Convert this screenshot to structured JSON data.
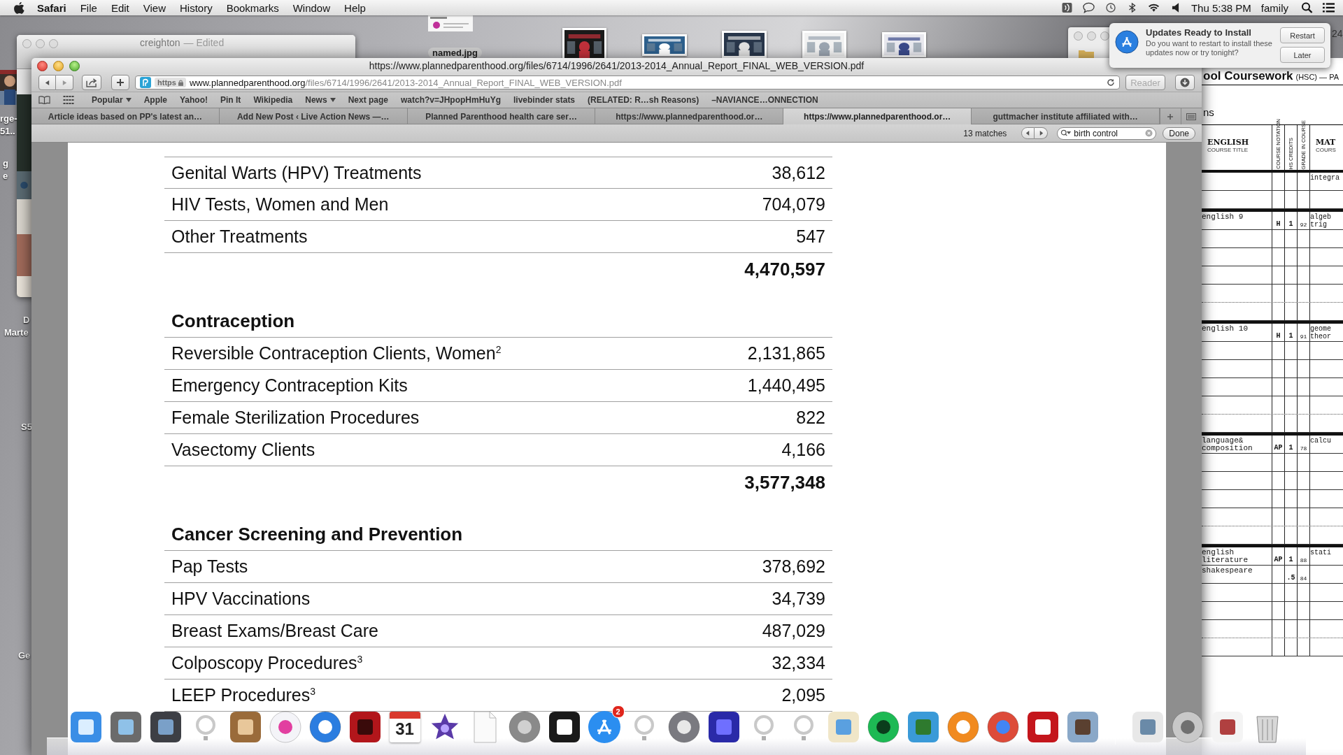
{
  "menu_bar": {
    "app": "Safari",
    "items": [
      "File",
      "Edit",
      "View",
      "History",
      "Bookmarks",
      "Window",
      "Help"
    ],
    "clock": "Thu 5:38 PM",
    "user": "family"
  },
  "desktop": {
    "labels": [
      "rge-",
      "51..",
      "g",
      "e",
      "D",
      "Marte",
      "S5",
      "Ge"
    ],
    "thumbnail_label": "named.jpg",
    "window_fragment": "24"
  },
  "background_window": {
    "title": "creighton",
    "status": "— Edited"
  },
  "safari": {
    "title": "https://www.plannedparenthood.org/files/6714/1996/2641/2013-2014_Annual_Report_FINAL_WEB_VERSION.pdf",
    "address": {
      "scheme": "https",
      "host": "www.plannedparenthood.org",
      "path": "/files/6714/1996/2641/2013-2014_Annual_Report_FINAL_WEB_VERSION.pdf"
    },
    "reader": "Reader",
    "bookmarks": [
      {
        "label": "Popular",
        "menu": true
      },
      {
        "label": "Apple",
        "menu": false
      },
      {
        "label": "Yahoo!",
        "menu": false
      },
      {
        "label": "Pin It",
        "menu": false
      },
      {
        "label": "Wikipedia",
        "menu": false
      },
      {
        "label": "News",
        "menu": true
      },
      {
        "label": "Next page",
        "menu": false
      },
      {
        "label": "watch?v=JHpopHmHuYg",
        "menu": false
      },
      {
        "label": "livebinder stats",
        "menu": false
      },
      {
        "label": "(RELATED: R…sh Reasons)",
        "menu": false
      },
      {
        "label": "–NAVIANCE…ONNECTION",
        "menu": false
      }
    ],
    "tabs": [
      {
        "label": "Article ideas based on PP's latest an…",
        "selected": false
      },
      {
        "label": "Add New Post ‹ Live Action News —…",
        "selected": false
      },
      {
        "label": "Planned Parenthood health care ser…",
        "selected": false
      },
      {
        "label": "https://www.plannedparenthood.or…",
        "selected": false
      },
      {
        "label": "https://www.plannedparenthood.or…",
        "selected": true
      },
      {
        "label": "guttmacher institute affiliated with…",
        "selected": false
      }
    ],
    "find": {
      "matches": "13 matches",
      "query": "birth control",
      "done": "Done"
    }
  },
  "report": {
    "sections": [
      {
        "rows": [
          {
            "label": "Genital Warts (HPV) Treatments",
            "value": "38,612"
          },
          {
            "label": "HIV Tests, Women and Men",
            "value": "704,079"
          },
          {
            "label": "Other Treatments",
            "value": "547"
          }
        ],
        "total": "4,470,597"
      },
      {
        "heading": "Contraception",
        "rows": [
          {
            "label": "Reversible Contraception Clients, Women$^{2}$",
            "value": "2,131,865"
          },
          {
            "label": "Emergency Contraception Kits",
            "value": "1,440,495"
          },
          {
            "label": "Female Sterilization Procedures",
            "value": "822"
          },
          {
            "label": "Vasectomy Clients",
            "value": "4,166"
          }
        ],
        "total": "3,577,348"
      },
      {
        "heading": "Cancer Screening and Prevention",
        "rows": [
          {
            "label": "Pap Tests",
            "value": "378,692"
          },
          {
            "label": "HPV Vaccinations",
            "value": "34,739"
          },
          {
            "label": "Breast Exams/Breast Care",
            "value": "487,029"
          },
          {
            "label": "Colposcopy Procedures$^{3}$",
            "value": "32,334"
          },
          {
            "label": "LEEP Procedures$^{3}$",
            "value": "2,095"
          }
        ]
      }
    ]
  },
  "coursework": {
    "title": "ool Coursework",
    "subtitle": "(HSC) — PA",
    "heading": "ns",
    "columns": {
      "subject": "ENGLISH",
      "title": "COURSE TITLE",
      "notation": "COURSE NOTATION",
      "credits": "HS CREDITS",
      "grade": "GRADE IN COURSE",
      "math": "MAT",
      "math_title": "COURS"
    },
    "groups": [
      {
        "rows": [
          {
            "math": "integra"
          }
        ]
      },
      {
        "rows": [
          {
            "title": "english 9",
            "notation": "H",
            "credits": "1",
            "grade": "92",
            "math": "algeb trig"
          }
        ]
      },
      {
        "rows": [
          {
            "title": "english 10",
            "notation": "H",
            "credits": "1",
            "grade": "91",
            "math": "geome theor"
          }
        ]
      },
      {
        "rows": [
          {
            "title": "language& composition",
            "notation": "AP",
            "credits": "1",
            "grade": "78",
            "math": "calcu"
          }
        ]
      },
      {
        "rows": [
          {
            "title": "english literature",
            "notation": "AP",
            "credits": "1",
            "grade": "88",
            "math": "stati"
          },
          {
            "title": "shakespeare",
            "credits": ".5",
            "grade": "84"
          }
        ]
      }
    ]
  },
  "notification": {
    "title": "Updates Ready to Install",
    "message": "Do you want to restart to install these updates now or try tonight?",
    "buttons": [
      "Restart",
      "Later"
    ]
  },
  "dock": {
    "calendar_day": "31",
    "badge": "2"
  }
}
